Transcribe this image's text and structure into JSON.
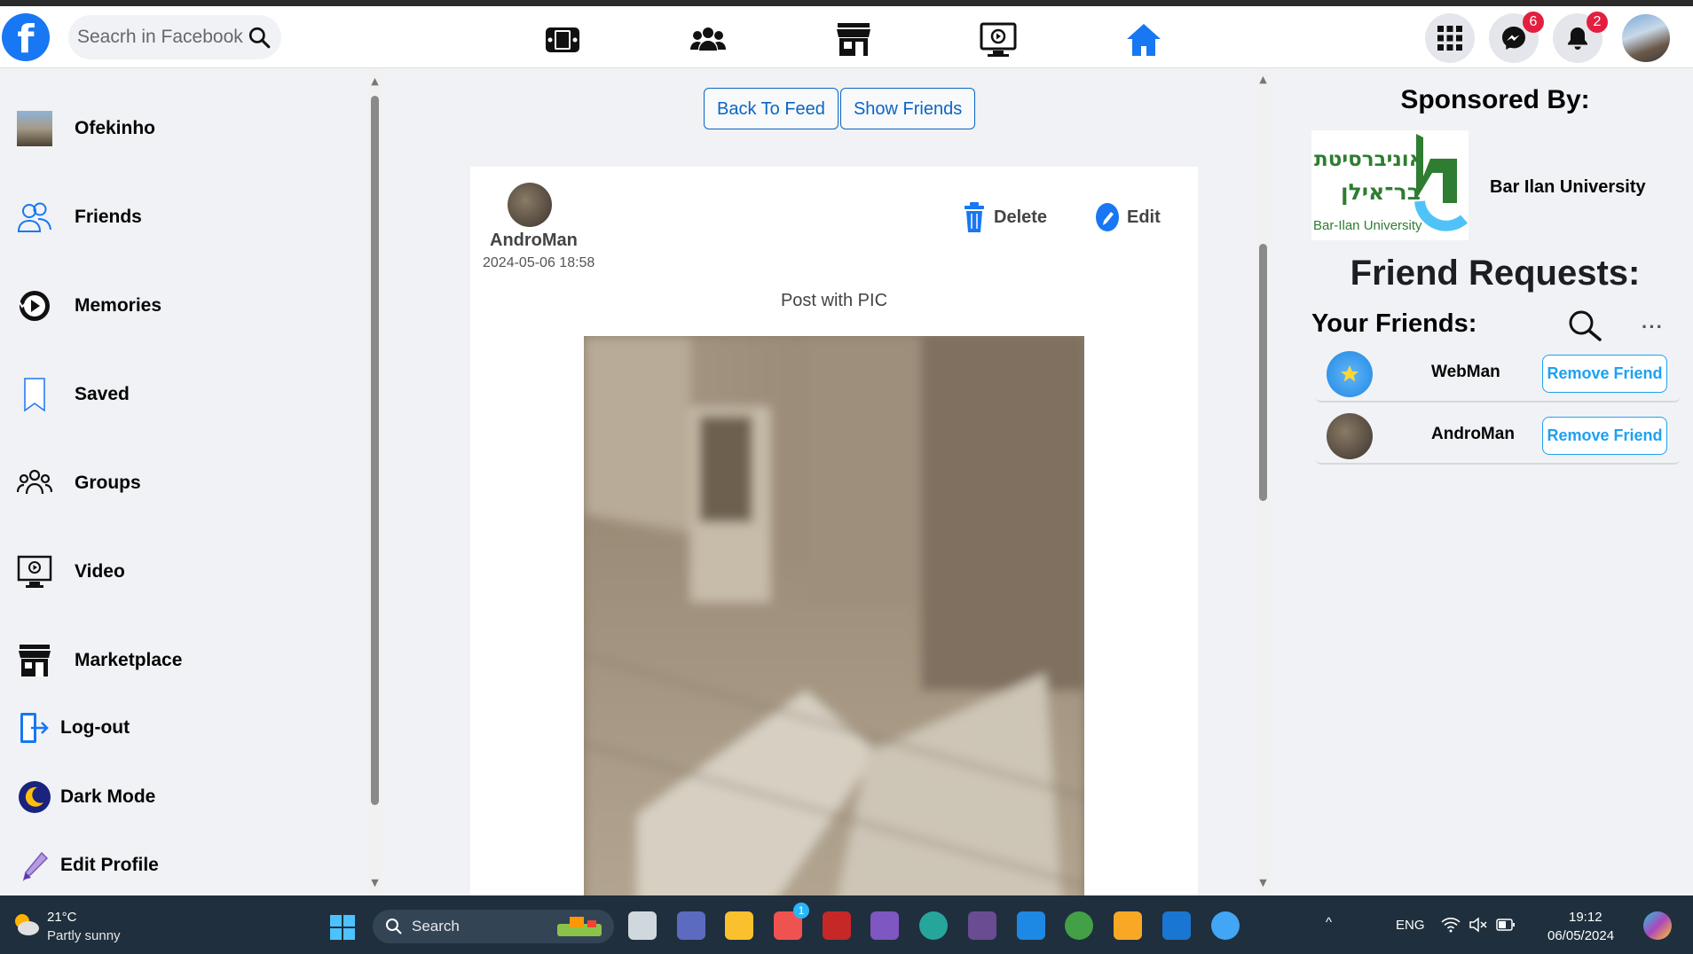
{
  "topbar": {
    "logo": "f",
    "search_placeholder": "Seacrh in Facebook",
    "nav_icons": [
      "gaming-icon",
      "groups-icon",
      "marketplace-icon",
      "video-icon",
      "home-icon"
    ],
    "messenger_badge": "6",
    "notifications_badge": "2"
  },
  "sidebar": {
    "profile_name": "Ofekinho",
    "items": [
      {
        "label": "Friends",
        "icon": "friends-icon"
      },
      {
        "label": "Memories",
        "icon": "memories-icon"
      },
      {
        "label": "Saved",
        "icon": "bookmark-icon"
      },
      {
        "label": "Groups",
        "icon": "groups-icon"
      },
      {
        "label": "Video",
        "icon": "video-icon"
      },
      {
        "label": "Marketplace",
        "icon": "marketplace-icon"
      },
      {
        "label": "Log-out",
        "icon": "logout-icon"
      },
      {
        "label": "Dark Mode",
        "icon": "moon-icon"
      },
      {
        "label": "Edit Profile",
        "icon": "pencil-icon"
      }
    ]
  },
  "feed": {
    "back_to_feed": "Back To Feed",
    "show_friends": "Show Friends",
    "post": {
      "author": "AndroMan",
      "date": "2024-05-06 18:58",
      "delete_label": "Delete",
      "edit_label": "Edit",
      "text": "Post with PIC"
    }
  },
  "rightbar": {
    "sponsored_title": "Sponsored By:",
    "sponsor_name": "Bar Ilan University",
    "sponsor_logo_hebrew_line1": "אוניברסיטת",
    "sponsor_logo_hebrew_line2": "בר־אילן",
    "sponsor_logo_english": "Bar-Ilan University",
    "friend_requests_title": "Friend Requests:",
    "your_friends_title": "Your Friends:",
    "more": "···",
    "friends": [
      {
        "name": "WebMan",
        "button": "Remove Friend"
      },
      {
        "name": "AndroMan",
        "button": "Remove Friend"
      }
    ]
  },
  "taskbar": {
    "temperature": "21°C",
    "weather": "Partly sunny",
    "search_label": "Search",
    "store_badge": "1",
    "language": "ENG",
    "time": "19:12",
    "date": "06/05/2024"
  }
}
